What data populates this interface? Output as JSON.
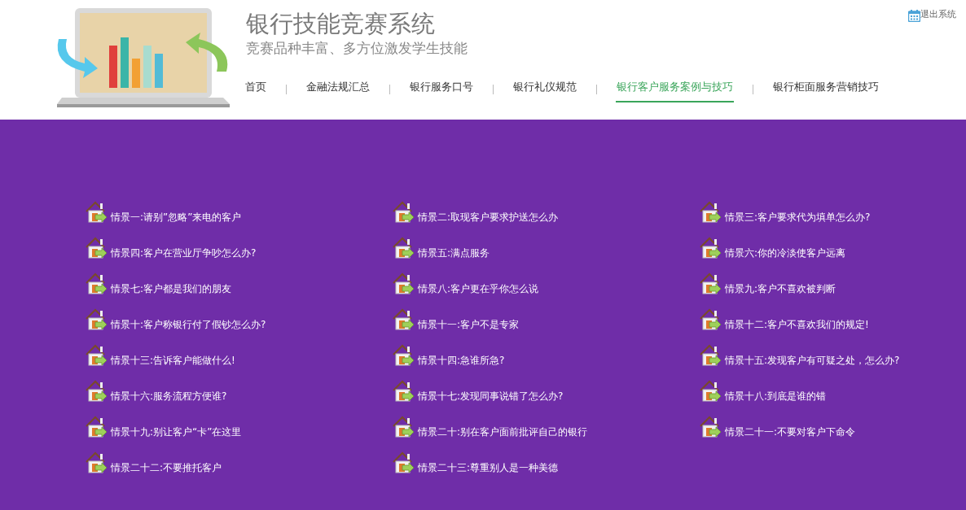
{
  "header": {
    "title": "银行技能竞赛系统",
    "subtitle": "竞赛品种丰富、多方位激发学生技能",
    "logout": "退出系统"
  },
  "nav": [
    {
      "label": "首页",
      "selected": false
    },
    {
      "label": "金融法规汇总",
      "selected": false
    },
    {
      "label": "银行服务口号",
      "selected": false
    },
    {
      "label": "银行礼仪规范",
      "selected": false
    },
    {
      "label": "银行客户服务案例与技巧",
      "selected": true
    },
    {
      "label": "银行柜面服务营销技巧",
      "selected": false
    }
  ],
  "scenarios": [
    "情景一:请别”忽略”来电的客户",
    "情景二:取现客户要求护送怎么办",
    "情景三:客户要求代为填单怎么办?",
    "情景四:客户在营业厅争吵怎么办?",
    "情景五:满点服务",
    "情景六:你的冷淡使客户远离",
    "情景七:客户都是我们的朋友",
    "情景八:客户更在乎你怎么说",
    "情景九:客户不喜欢被判断",
    "情景十:客户称银行付了假钞怎么办?",
    "情景十一:客户不是专家",
    "情景十二:客户不喜欢我们的规定!",
    "情景十三:告诉客户能做什么!",
    "情景十四:急谁所急?",
    "情景十五:发现客户有可疑之处，怎么办?",
    "情景十六:服务流程方便谁?",
    "情景十七:发现同事说错了怎么办?",
    "情景十八:到底是谁的错",
    "情景十九:别让客户“卡”在这里",
    "情景二十:别在客户面前批评自己的银行",
    "情景二十一:不要对客户下命令",
    "情景二十二:不要推托客户",
    "情景二十三:尊重别人是一种美德"
  ]
}
